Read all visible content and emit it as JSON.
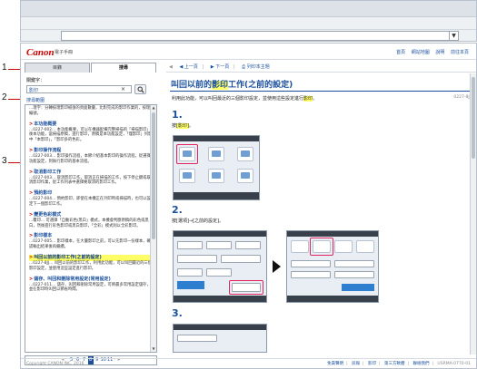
{
  "browser": {
    "address": ""
  },
  "header": {
    "logo": "Canon",
    "product": "電子手冊",
    "links": [
      "首頁",
      "網站地圖",
      "說明",
      "前往本頁"
    ]
  },
  "tabs": {
    "contents": "目錄",
    "search": "搜尋"
  },
  "search": {
    "label": "關鍵字：",
    "value": "影印",
    "clear_glyph": "×",
    "range_label": "搜尋範圍"
  },
  "callouts": [
    "1",
    "2",
    "3"
  ],
  "results": [
    {
      "title": "",
      "snippet": "…理字：分轉按理影印紙張的頁面數量，比對完成的影印作業的，按理編號。"
    },
    {
      "title": "本功能概要",
      "snippet": "…0227-002… 本功能概要，可以在機器配備完整掃描的「掃描影印」後本功能，當掃描原稿，進行影印，原稿是本功能設定，「僅影印」列影中「本影印」，「影印多的色彩。"
    },
    {
      "title": "影印操作流程",
      "snippet": "…0227-003… 影印操作流程，本節介紹基本影印的操作流程，從選擇功能設定，到執行影印的基本流程。"
    },
    {
      "title": "取消影印工作",
      "snippet": "…0227-003… 取消影印工作，取消正在掃描的工作，按下停止鍵或取消影印作業，從工作列表中選擇要取消的影印工作。"
    },
    {
      "title": "預約影印",
      "snippet": "…0227-004… 預約影印，即使在本機正在列印時或掃描時，也可以設定下一個影印工作。"
    },
    {
      "title": "變更色彩模式",
      "snippet": "…覆印… 可選擇「自動彩色/黑白」模式，本機會判斷原稿的彩色或黑白，然後進行彩色影印或黑白影印，「全彩」模式則以全彩影印。"
    },
    {
      "title": "影印樣本",
      "snippet": "…0227-005… 影印樣本，在大量影印之前，可以先影印一份樣本，確認輸出結果後再繼續。"
    },
    {
      "title": "叫回以前的影印工作(之前的設定)",
      "highlight": true,
      "snippet": "…0227-8JJ… 叫回以前的影印工作，利用此功能，可以叫回最近的三個影印設定，並使用這些設定進行影印。"
    },
    {
      "title": "儲存、叫回和刪除常用設定(常用設定)",
      "snippet": "…0227-011… 儲存、叫回和刪除常用設定，可將最多常用設定儲存，並在影印時叫回以節省時間。"
    }
  ],
  "pager": {
    "prev": "«",
    "pages": [
      "5",
      "6",
      "7",
      "8",
      "9",
      "10",
      "11"
    ],
    "current": "8",
    "next": "»"
  },
  "toolbar": {
    "prev": "上一頁",
    "next": "下一頁",
    "print": "列印本主題"
  },
  "article": {
    "title_pre": "叫回以前的",
    "title_hl": "影印",
    "title_post": "工作(之前的設定)",
    "intro_pre": "利用此功能，可以叫回最近的三個影印設定，並使用這些設定進行",
    "intro_hl": "影印",
    "intro_post": "。",
    "doc_id": "0227-8JJ",
    "steps": [
      {
        "num": "1.",
        "text_pre": "按",
        "text_hl": "[影印]",
        "text_post": "。"
      },
      {
        "num": "2.",
        "text_pre": "按[選項]→[之前的設定]。",
        "text_hl": "",
        "text_post": ""
      },
      {
        "num": "3.",
        "text_pre": "",
        "text_hl": "",
        "text_post": ""
      }
    ]
  },
  "footer": {
    "copyright": "Copyright CANON INC. 2016",
    "links": [
      "免責聲明",
      "訊報",
      "影印",
      "第三方軟體",
      "聯絡我們"
    ],
    "code": "USRMA-0770-01"
  }
}
